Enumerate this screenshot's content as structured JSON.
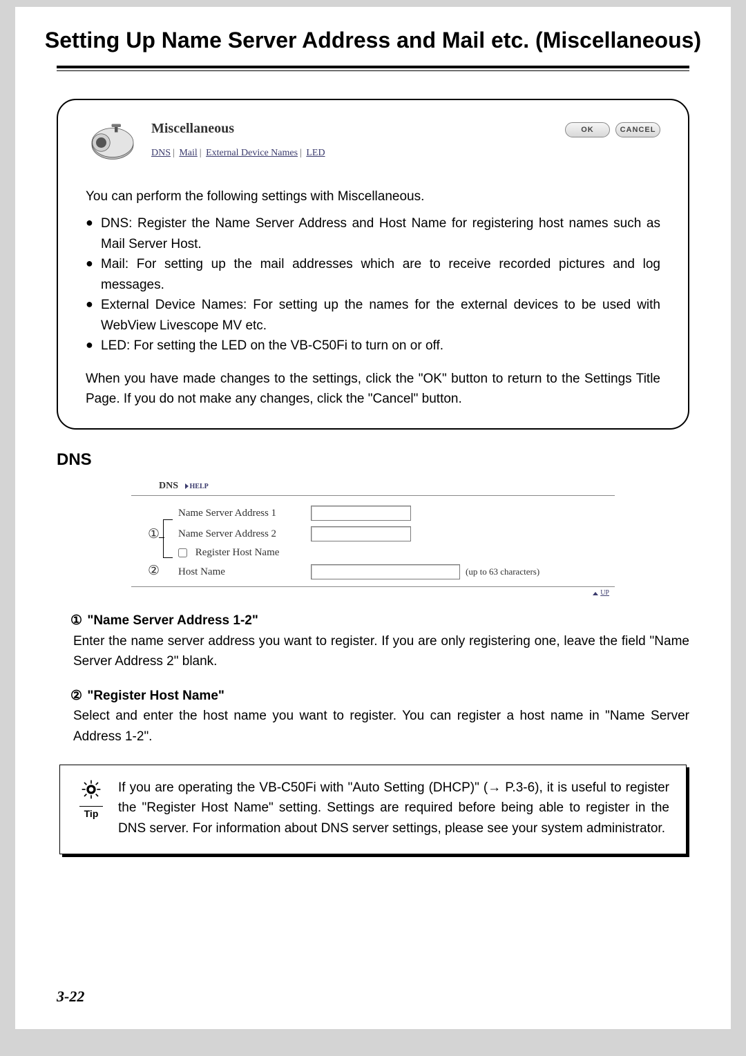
{
  "pageTitle": "Setting Up Name Server Address and Mail etc. (Miscellaneous)",
  "header": {
    "title": "Miscellaneous",
    "links": [
      "DNS",
      "Mail",
      "External Device Names",
      "LED"
    ],
    "ok": "OK",
    "cancel": "CANCEL"
  },
  "intro": "You can perform the following settings with Miscellaneous.",
  "bullets": [
    "DNS: Register the Name Server Address and Host Name for registering host names such as Mail Server Host.",
    "Mail: For setting up the mail addresses which are to receive recorded pictures and log messages.",
    "External Device Names: For setting up the names for the external devices to be used with WebView Livescope MV etc.",
    "LED: For setting the LED on the VB-C50Fi to turn on or off."
  ],
  "afterBullets": "When you have made changes to the settings, click the \"OK\" button to return to the Settings Title Page. If you do not make any changes, click the \"Cancel\" button.",
  "dnsHeading": "DNS",
  "dns": {
    "barLabel": "DNS",
    "help": "HELP",
    "nsa1": "Name Server Address 1",
    "nsa2": "Name Server Address 2",
    "regHost": "Register Host Name",
    "hostName": "Host Name",
    "hostNote": "(up to 63 characters)",
    "up": "UP",
    "callout1": "①",
    "callout2": "②"
  },
  "desc": [
    {
      "num": "①",
      "title": "\"Name Server Address 1-2\"",
      "body": "Enter the name server address you want to register. If you are only registering one, leave the field \"Name Server Address 2\" blank."
    },
    {
      "num": "②",
      "title": "\"Register Host Name\"",
      "body": "Select and enter the host name you want to register. You can register a host name in \"Name Server Address 1-2\"."
    }
  ],
  "tip": {
    "label": "Tip",
    "text": "If you are operating the VB-C50Fi with \"Auto Setting (DHCP)\" (→ P.3-6), it is useful to register the \"Register Host Name\" setting. Settings are required before being able to register in the DNS server. For information about DNS server settings, please see your system administrator."
  },
  "pageNumber": "3-22"
}
